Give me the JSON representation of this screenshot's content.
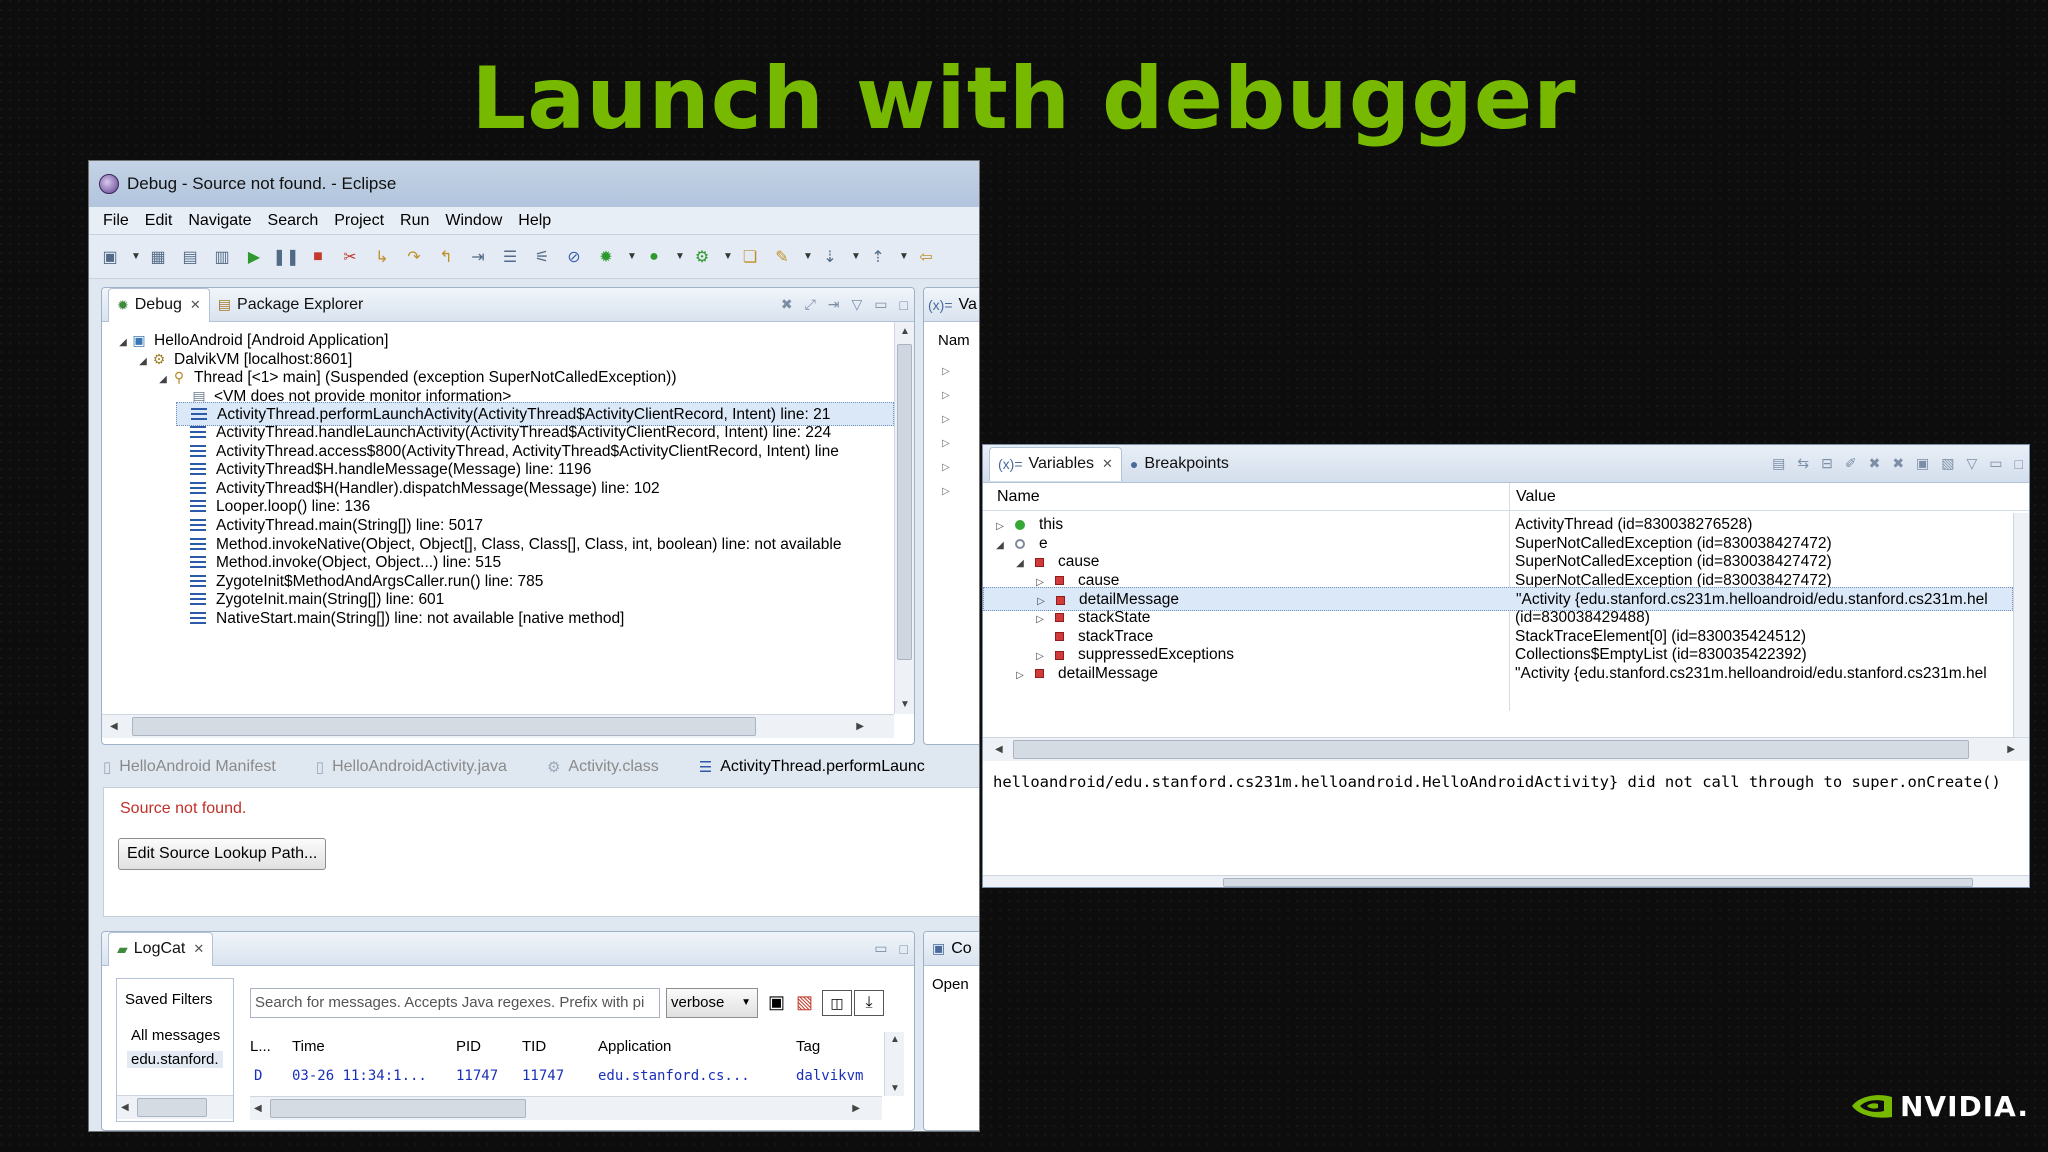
{
  "slide": {
    "title": "Launch with debugger"
  },
  "window": {
    "title": "Debug - Source not found. - Eclipse",
    "menu": [
      "File",
      "Edit",
      "Navigate",
      "Search",
      "Project",
      "Run",
      "Window",
      "Help"
    ]
  },
  "debug_view": {
    "tabs": [
      "Debug",
      "Package Explorer"
    ],
    "tree": [
      {
        "depth": 0,
        "twisty": "open",
        "icon": "android-app-icon",
        "label": "HelloAndroid [Android Application]"
      },
      {
        "depth": 1,
        "twisty": "open",
        "icon": "vm-icon",
        "label": "DalvikVM [localhost:8601]"
      },
      {
        "depth": 2,
        "twisty": "open",
        "icon": "thread-icon",
        "label": "Thread [<1> main] (Suspended (exception SuperNotCalledException))"
      },
      {
        "depth": 3,
        "twisty": "none",
        "icon": "monitor-icon",
        "label": "<VM does not provide monitor information>"
      },
      {
        "depth": 3,
        "twisty": "none",
        "icon": "stack-frame-icon",
        "label": "ActivityThread.performLaunchActivity(ActivityThread$ActivityClientRecord, Intent) line: 21",
        "selected": true
      },
      {
        "depth": 3,
        "twisty": "none",
        "icon": "stack-frame-icon",
        "label": "ActivityThread.handleLaunchActivity(ActivityThread$ActivityClientRecord, Intent) line: 224"
      },
      {
        "depth": 3,
        "twisty": "none",
        "icon": "stack-frame-icon",
        "label": "ActivityThread.access$800(ActivityThread, ActivityThread$ActivityClientRecord, Intent) line"
      },
      {
        "depth": 3,
        "twisty": "none",
        "icon": "stack-frame-icon",
        "label": "ActivityThread$H.handleMessage(Message) line: 1196"
      },
      {
        "depth": 3,
        "twisty": "none",
        "icon": "stack-frame-icon",
        "label": "ActivityThread$H(Handler).dispatchMessage(Message) line: 102"
      },
      {
        "depth": 3,
        "twisty": "none",
        "icon": "stack-frame-icon",
        "label": "Looper.loop() line: 136"
      },
      {
        "depth": 3,
        "twisty": "none",
        "icon": "stack-frame-icon",
        "label": "ActivityThread.main(String[]) line: 5017"
      },
      {
        "depth": 3,
        "twisty": "none",
        "icon": "stack-frame-icon",
        "label": "Method.invokeNative(Object, Object[], Class, Class[], Class, int, boolean) line: not available"
      },
      {
        "depth": 3,
        "twisty": "none",
        "icon": "stack-frame-icon",
        "label": "Method.invoke(Object, Object...) line: 515"
      },
      {
        "depth": 3,
        "twisty": "none",
        "icon": "stack-frame-icon",
        "label": "ZygoteInit$MethodAndArgsCaller.run() line: 785"
      },
      {
        "depth": 3,
        "twisty": "none",
        "icon": "stack-frame-icon",
        "label": "ZygoteInit.main(String[]) line: 601"
      },
      {
        "depth": 3,
        "twisty": "none",
        "icon": "stack-frame-icon",
        "label": "NativeStart.main(String[]) line: not available [native method]"
      }
    ]
  },
  "side_stub": {
    "tab": "Va",
    "col": "Nam",
    "tab2": "Co",
    "text2": "Open"
  },
  "editor": {
    "tabs": [
      "HelloAndroid Manifest",
      "HelloAndroidActivity.java",
      "Activity.class",
      "ActivityThread.performLaunc"
    ],
    "message": "Source not found.",
    "button": "Edit Source Lookup Path..."
  },
  "logcat": {
    "tab": "LogCat",
    "filters_title": "Saved Filters",
    "filters": [
      "All messages",
      "edu.stanford."
    ],
    "search_placeholder": "Search for messages. Accepts Java regexes. Prefix with pi",
    "level": "verbose",
    "columns": [
      "L...",
      "Time",
      "PID",
      "TID",
      "Application",
      "Tag"
    ],
    "row": {
      "level": "D",
      "time": "03-26 11:34:1...",
      "pid": "11747",
      "tid": "11747",
      "app": "edu.stanford.cs...",
      "tag": "dalvikvm"
    }
  },
  "variables": {
    "tabs": [
      "Variables",
      "Breakpoints"
    ],
    "columns": [
      "Name",
      "Value"
    ],
    "rows": [
      {
        "depth": 0,
        "twisty": "closed",
        "icon": "field-public-icon",
        "name": "this",
        "value": "ActivityThread  (id=830038276528)"
      },
      {
        "depth": 0,
        "twisty": "open",
        "icon": "local-var-icon",
        "name": "e",
        "value": "SuperNotCalledException  (id=830038427472)"
      },
      {
        "depth": 1,
        "twisty": "open",
        "icon": "field-private-icon",
        "name": "cause",
        "value": "SuperNotCalledException  (id=830038427472)"
      },
      {
        "depth": 2,
        "twisty": "closed",
        "icon": "field-private-icon",
        "name": "cause",
        "value": "SuperNotCalledException  (id=830038427472)"
      },
      {
        "depth": 2,
        "twisty": "closed",
        "icon": "field-private-icon",
        "name": "detailMessage",
        "value": "\"Activity {edu.stanford.cs231m.helloandroid/edu.stanford.cs231m.hel",
        "selected": true
      },
      {
        "depth": 2,
        "twisty": "closed",
        "icon": "field-private-icon",
        "name": "stackState",
        "value": "(id=830038429488)"
      },
      {
        "depth": 2,
        "twisty": "none",
        "icon": "field-private-icon",
        "name": "stackTrace",
        "value": "StackTraceElement[0]  (id=830035424512)"
      },
      {
        "depth": 2,
        "twisty": "closed",
        "icon": "field-private-icon",
        "name": "suppressedExceptions",
        "value": "Collections$EmptyList  (id=830035422392)"
      },
      {
        "depth": 1,
        "twisty": "closed",
        "icon": "field-private-icon",
        "name": "detailMessage",
        "value": "\"Activity {edu.stanford.cs231m.helloandroid/edu.stanford.cs231m.hel"
      }
    ],
    "detail": "helloandroid/edu.stanford.cs231m.helloandroid.HelloAndroidActivity} did not call through to super.onCreate()"
  },
  "brand": {
    "name": "NVIDIA.",
    "accent": "#76b900"
  }
}
